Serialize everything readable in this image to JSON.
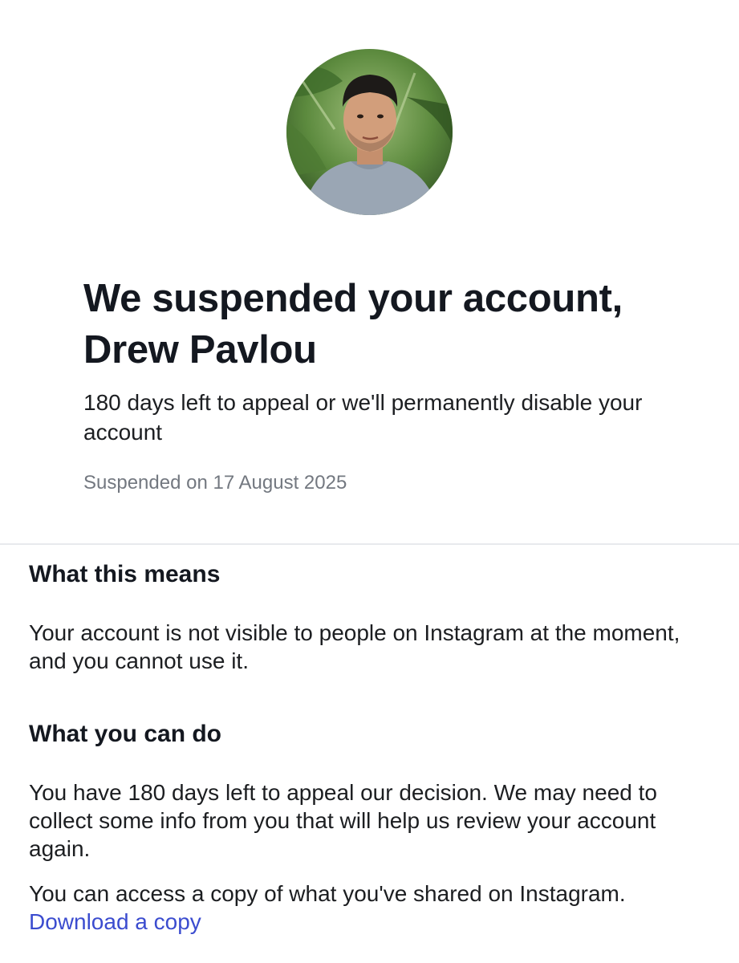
{
  "profile": {
    "avatar_alt": "Profile photo"
  },
  "header": {
    "title": "We suspended your account, Drew Pavlou",
    "subtitle": "180 days left to appeal or we'll permanently disable your account",
    "suspended_date": "Suspended on 17 August 2025"
  },
  "what_this_means": {
    "heading": "What this means",
    "body": "Your account is not visible to people on Instagram at the moment, and you cannot use it."
  },
  "what_you_can_do": {
    "heading": "What you can do",
    "body": "You have 180 days left to appeal our decision. We may need to collect some info from you that will help us review your account again.",
    "access_text": "You can access a copy of what you've shared on Instagram.",
    "download_link": "Download a copy"
  },
  "colors": {
    "link": "#3b4ccf",
    "muted_text": "#737880",
    "divider": "#e8eaed"
  }
}
